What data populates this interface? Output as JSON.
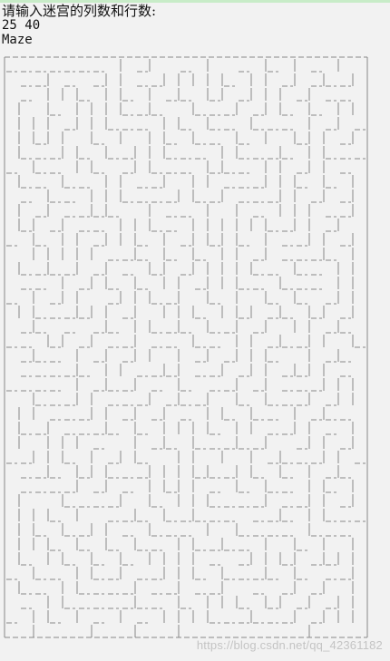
{
  "console": {
    "prompt": "请输入迷宫的列数和行数:",
    "input_echo": "25 40",
    "heading": "Maze"
  },
  "maze": {
    "columns": 25,
    "rows": 40,
    "wall_color": "#888888",
    "wall_characters": [
      "_",
      "|"
    ]
  },
  "watermark": "https://blog.csdn.net/qq_42361182"
}
